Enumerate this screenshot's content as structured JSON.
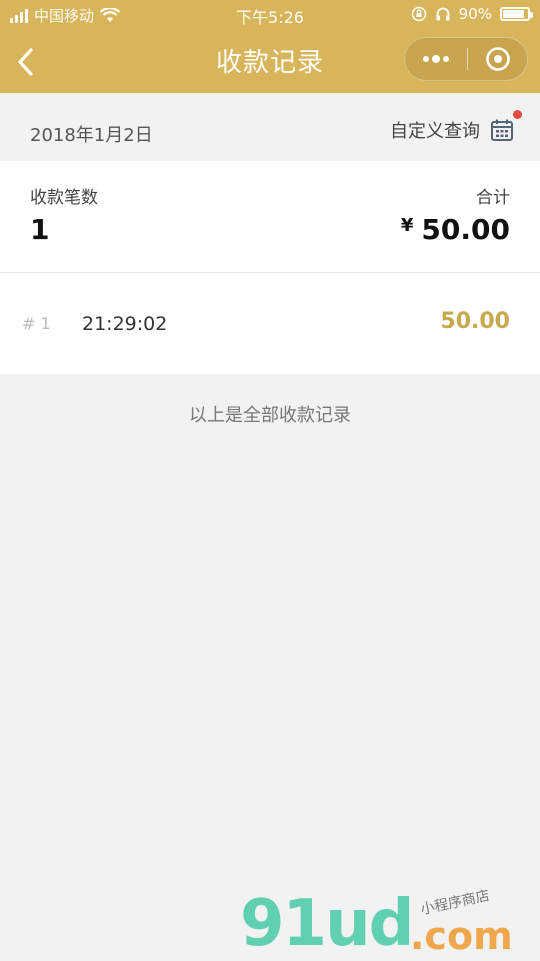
{
  "status_bar": {
    "carrier": "中国移动",
    "time": "下午5:26",
    "battery_text": "90%",
    "battery_level": 0.9
  },
  "nav": {
    "title": "收款记录",
    "back_icon": "chevron-left-icon",
    "menu_icon": "more-dots-icon",
    "close_icon": "target-icon"
  },
  "date_bar": {
    "date": "2018年1月2日",
    "custom_query": "自定义查询",
    "calendar_icon": "calendar-icon",
    "badge_color": "#e14b3b"
  },
  "summary": {
    "count_label": "收款笔数",
    "count_value": "1",
    "total_label": "合计",
    "currency": "¥",
    "total_value": "50.00"
  },
  "records": [
    {
      "index": "# 1",
      "time": "21:29:02",
      "amount": "50.00"
    }
  ],
  "footer_note": "以上是全部收款记录",
  "watermark": {
    "main": "91ud",
    "suffix": ".com",
    "tagline": "小程序商店"
  },
  "colors": {
    "header": "#d8b55a",
    "amount": "#c8a94d",
    "background": "#f2f2f2"
  }
}
